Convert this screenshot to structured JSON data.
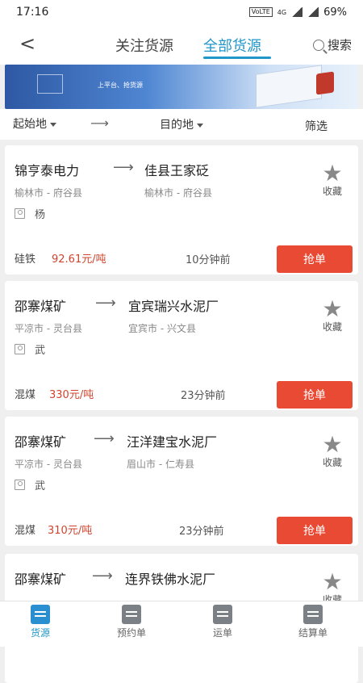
{
  "status": {
    "time": "17:16",
    "net": "4G",
    "lte": "VoLTE",
    "battery": "69%"
  },
  "header": {
    "back": "<",
    "tab_follow": "关注货源",
    "tab_all": "全部货源",
    "search": "搜索"
  },
  "banner": {
    "text": "上平台、抢货源"
  },
  "filter": {
    "from": "起始地",
    "arrow": "⟶",
    "to": "目的地",
    "screen": "筛选"
  },
  "cards": [
    {
      "from": "锦亨泰电力",
      "to": "佳县王家砭",
      "from_city": "榆林市 - 府谷县",
      "to_city": "榆林市 - 府谷县",
      "user": "杨",
      "fav": "收藏",
      "cargo": "硅铁",
      "price": "92.61元/吨",
      "time": "10分钟前",
      "grab": "抢单"
    },
    {
      "from": "邵寨煤矿",
      "to": "宜宾瑞兴水泥厂",
      "from_city": "平凉市 - 灵台县",
      "to_city": "宜宾市 - 兴文县",
      "user": "武",
      "fav": "收藏",
      "cargo": "混煤",
      "price": "330元/吨",
      "time": "23分钟前",
      "grab": "抢单"
    },
    {
      "from": "邵寨煤矿",
      "to": "汪洋建宝水泥厂",
      "from_city": "平凉市 - 灵台县",
      "to_city": "眉山市 - 仁寿县",
      "user": "武",
      "fav": "收藏",
      "cargo": "混煤",
      "price": "310元/吨",
      "time": "23分钟前",
      "grab": "抢单"
    },
    {
      "from": "邵寨煤矿",
      "to": "连界铁佛水泥厂",
      "fav": "收藏"
    }
  ],
  "tabbar": {
    "source": "货源",
    "booking": "预约单",
    "waybill": "运单",
    "settle": "结算单"
  }
}
